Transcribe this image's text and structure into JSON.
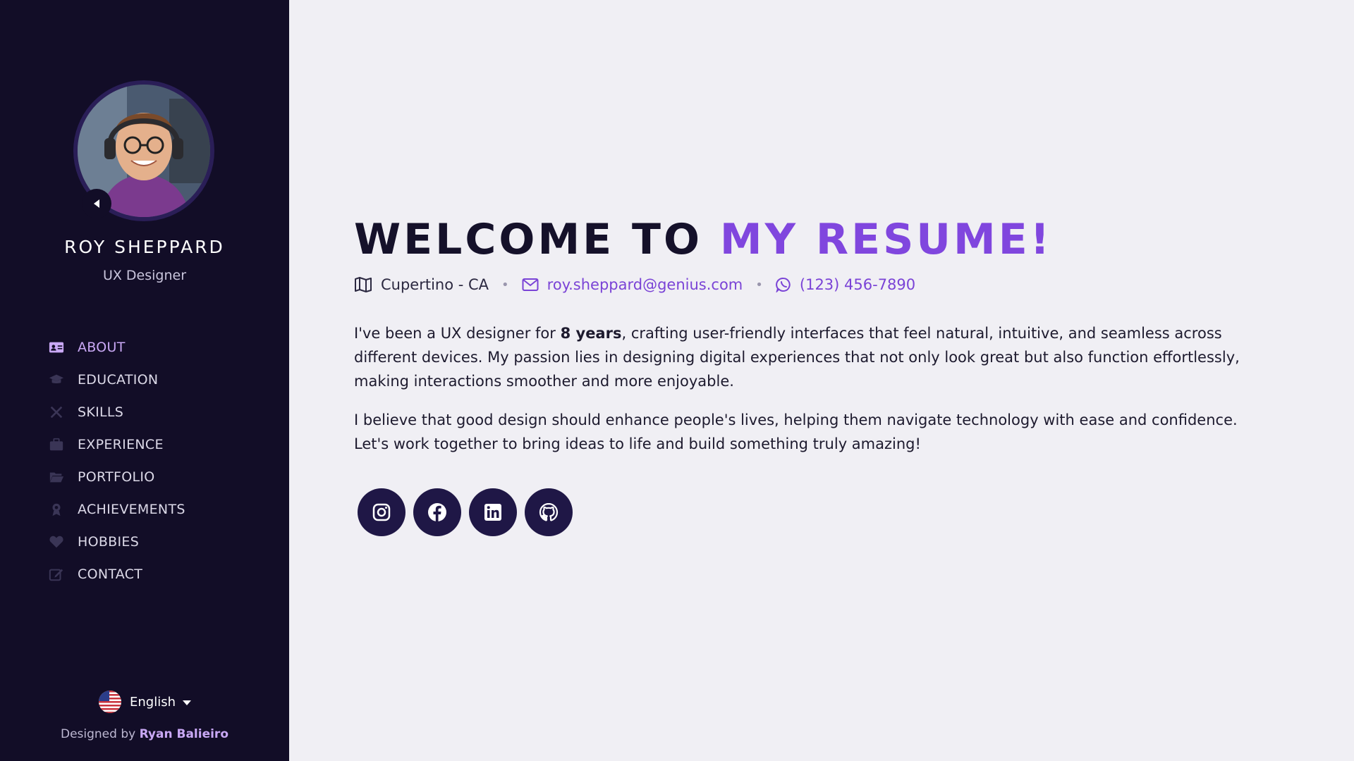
{
  "profile": {
    "name": "ROY SHEPPARD",
    "role": "UX Designer"
  },
  "nav": {
    "items": [
      {
        "label": "ABOUT",
        "icon": "id-card-icon",
        "active": true
      },
      {
        "label": "EDUCATION",
        "icon": "graduation-cap-icon"
      },
      {
        "label": "SKILLS",
        "icon": "tools-icon"
      },
      {
        "label": "EXPERIENCE",
        "icon": "briefcase-icon"
      },
      {
        "label": "PORTFOLIO",
        "icon": "folder-open-icon"
      },
      {
        "label": "ACHIEVEMENTS",
        "icon": "award-icon"
      },
      {
        "label": "HOBBIES",
        "icon": "heart-icon"
      },
      {
        "label": "CONTACT",
        "icon": "edit-icon"
      }
    ]
  },
  "language": {
    "selected": "English"
  },
  "credits": {
    "prefix": "Designed by",
    "author": "Ryan Balieiro"
  },
  "main": {
    "headline_part1": "WELCOME TO",
    "headline_part2": "MY RESUME!",
    "location": "Cupertino - CA",
    "email": "roy.sheppard@genius.com",
    "phone": "(123) 456-7890",
    "bio_p1_before": "I've been a UX designer for",
    "bio_p1_bold": "8 years",
    "bio_p1_after": ", crafting user-friendly interfaces that feel natural, intuitive, and seamless across different devices. My passion lies in designing digital experiences that not only look great but also function effortlessly, making interactions smoother and more enjoyable.",
    "bio_p2": "I believe that good design should enhance people's lives, helping them navigate technology with ease and confidence. Let's work together to bring ideas to life and build something truly amazing!"
  },
  "socials": [
    "instagram-icon",
    "facebook-icon",
    "linkedin-icon",
    "github-icon"
  ],
  "colors": {
    "sidebar_bg": "#120d27",
    "main_bg": "#f0eff4",
    "accent": "#8046de",
    "nav_active": "#c9a8f5",
    "social_bg": "#1f1746"
  }
}
